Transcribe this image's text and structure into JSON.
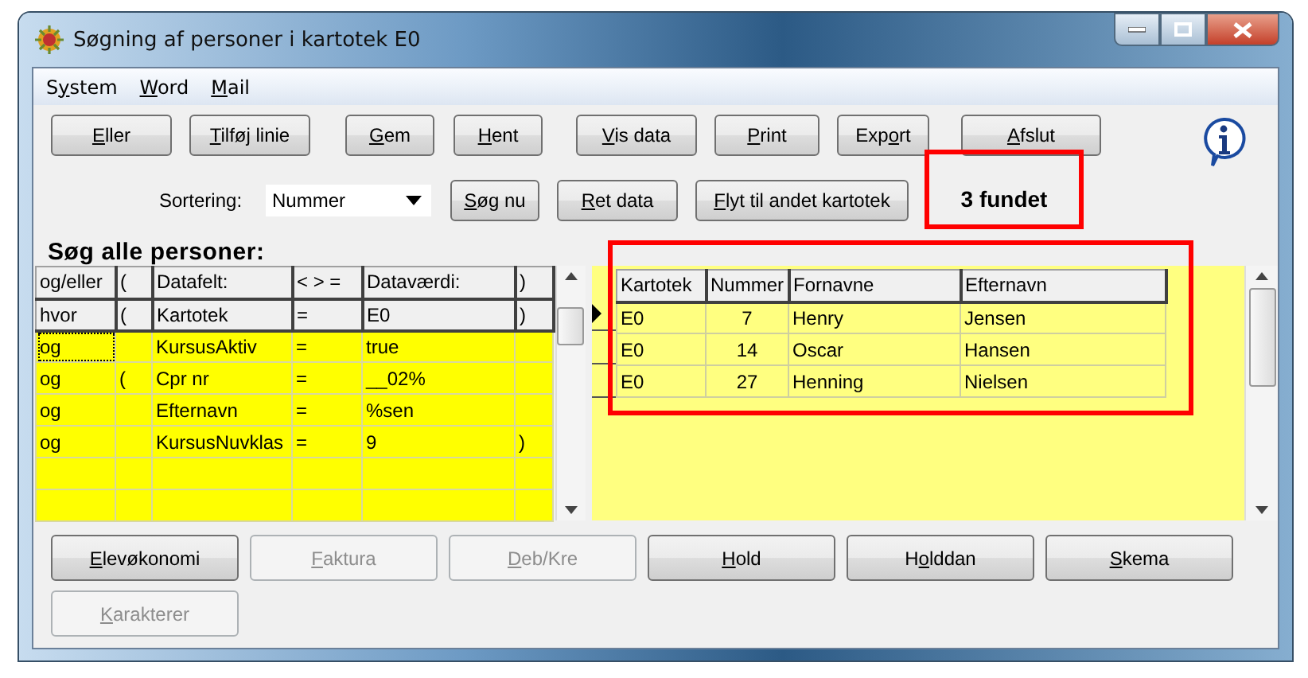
{
  "window": {
    "title": "Søgning af personer i kartotek E0"
  },
  "menu": [
    {
      "pre": "S",
      "key": "y",
      "post": "stem"
    },
    {
      "key": "W",
      "post": "ord"
    },
    {
      "key": "M",
      "post": "ail"
    }
  ],
  "toolbar_row1": [
    {
      "key": "E",
      "post": "ller"
    },
    {
      "key": "T",
      "post": "ilføj linie"
    },
    {
      "key": "G",
      "post": "em"
    },
    {
      "key": "H",
      "post": "ent"
    },
    {
      "key": "V",
      "post": "is data"
    },
    {
      "key": "P",
      "post": "rint"
    },
    {
      "pre": "Exp",
      "key": "o",
      "post": "rt"
    },
    {
      "key": "A",
      "post": "fslut"
    }
  ],
  "sorting": {
    "label": "Sortering:",
    "value": "Nummer"
  },
  "toolbar_row2": [
    {
      "key": "S",
      "post": "øg nu"
    },
    {
      "key": "R",
      "post": "et data"
    },
    {
      "key": "F",
      "post": "lyt til andet kartotek"
    }
  ],
  "result_count": {
    "text": "3 fundet",
    "highlighted": true
  },
  "criteria": {
    "title": "Søg alle personer:",
    "columns": [
      "og/eller",
      "(",
      "Datafelt:",
      "< > =",
      "Dataværdi:",
      ")"
    ],
    "rows": [
      {
        "kind": "fixed",
        "cells": [
          "hvor",
          "(",
          "Kartotek",
          "=",
          "E0",
          ")"
        ]
      },
      {
        "kind": "edit",
        "focused": true,
        "cells": [
          "og",
          "",
          "KursusAktiv",
          "=",
          "true",
          ""
        ]
      },
      {
        "kind": "edit",
        "focused": false,
        "cells": [
          "og",
          "(",
          "Cpr nr",
          "=",
          "__02%",
          ""
        ]
      },
      {
        "kind": "edit",
        "focused": false,
        "cells": [
          "og",
          "",
          "Efternavn",
          "=",
          "%sen",
          ""
        ]
      },
      {
        "kind": "edit",
        "focused": false,
        "cells": [
          "og",
          "",
          "KursusNuvklas",
          "=",
          "9",
          ")"
        ]
      },
      {
        "kind": "edit",
        "focused": false,
        "cells": [
          "",
          "",
          "",
          "",
          "",
          ""
        ]
      },
      {
        "kind": "edit",
        "focused": false,
        "cells": [
          "",
          "",
          "",
          "",
          "",
          ""
        ]
      }
    ]
  },
  "results": {
    "highlighted": true,
    "columns": [
      "Kartotek",
      "Nummer",
      "Fornavne",
      "Efternavn"
    ],
    "rows": [
      {
        "selected": true,
        "cells": [
          "E0",
          "7",
          "Henry",
          "Jensen"
        ]
      },
      {
        "selected": false,
        "cells": [
          "E0",
          "14",
          "Oscar",
          "Hansen"
        ]
      },
      {
        "selected": false,
        "cells": [
          "E0",
          "27",
          "Henning",
          "Nielsen"
        ]
      }
    ]
  },
  "bottom_buttons": [
    {
      "key": "E",
      "post": "levøkonomi",
      "disabled": false
    },
    {
      "key": "F",
      "post": "aktura",
      "disabled": true
    },
    {
      "key": "D",
      "post": "eb/Kre",
      "disabled": true
    },
    {
      "key": "H",
      "post": "old",
      "disabled": false
    },
    {
      "pre": "H",
      "key": "o",
      "post": "lddan",
      "disabled": false
    },
    {
      "key": "S",
      "post": "kema",
      "disabled": false
    },
    {
      "key": "K",
      "post": "arakterer",
      "disabled": true
    }
  ]
}
